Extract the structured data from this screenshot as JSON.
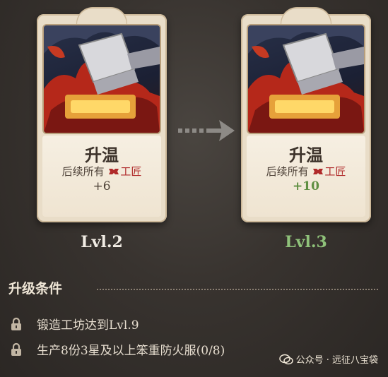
{
  "cards": [
    {
      "title": "升温",
      "desc_prefix": "后续所有",
      "desc_tag": "工匠",
      "value": "+6",
      "level": "Lvl.2",
      "level_color": "#f1ece4"
    },
    {
      "title": "升温",
      "desc_prefix": "后续所有",
      "desc_tag": "工匠",
      "value": "+10",
      "level": "Lvl.3",
      "level_color": "#8fc27a"
    }
  ],
  "arrow_icon": "right-arrow-icon",
  "conditions_title": "升级条件",
  "conditions": [
    {
      "icon": "lock-icon",
      "text": "锻造工坊达到Lvl.9"
    },
    {
      "icon": "lock-icon",
      "text": "生产8份3星及以上笨重防火服(0/8)"
    }
  ],
  "watermark": "公众号 · 远征八宝袋",
  "colors": {
    "accent_red": "#b02a2a",
    "upgrade_green": "#5f8f42",
    "card_bg": "#e9ddc8"
  }
}
